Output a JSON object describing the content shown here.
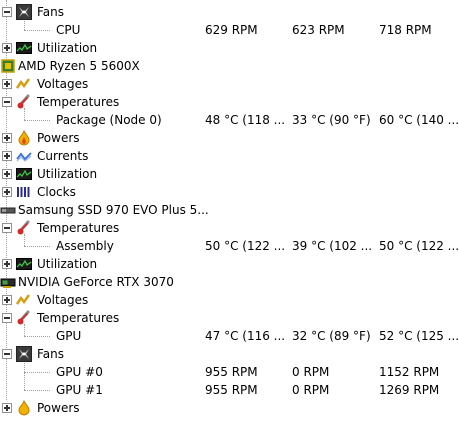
{
  "rows": [
    {
      "label": "Fans"
    },
    {
      "label": "CPU",
      "value": "629 RPM",
      "min": "623 RPM",
      "max": "718 RPM"
    },
    {
      "label": "Utilization"
    },
    {
      "label": "AMD Ryzen 5 5600X"
    },
    {
      "label": "Voltages"
    },
    {
      "label": "Temperatures"
    },
    {
      "label": "Package (Node 0)",
      "value": "48 °C  (118 ...",
      "min": "33 °C  (90 °F)",
      "max": "60 °C  (140 ..."
    },
    {
      "label": "Powers"
    },
    {
      "label": "Currents"
    },
    {
      "label": "Utilization"
    },
    {
      "label": "Clocks"
    },
    {
      "label": "Samsung SSD 970 EVO Plus 5..."
    },
    {
      "label": "Temperatures"
    },
    {
      "label": "Assembly",
      "value": "50 °C  (122 ...",
      "min": "39 °C  (102 ...",
      "max": "50 °C  (122 ..."
    },
    {
      "label": "Utilization"
    },
    {
      "label": "NVIDIA GeForce RTX 3070"
    },
    {
      "label": "Voltages"
    },
    {
      "label": "Temperatures"
    },
    {
      "label": "GPU",
      "value": "47 °C  (116 ...",
      "min": "32 °C  (89 °F)",
      "max": "52 °C  (125 ..."
    },
    {
      "label": "Fans"
    },
    {
      "label": "GPU #0",
      "value": "955 RPM",
      "min": "0 RPM",
      "max": "1152 RPM"
    },
    {
      "label": "GPU #1",
      "value": "955 RPM",
      "min": "0 RPM",
      "max": "1269 RPM"
    },
    {
      "label": "Powers"
    }
  ],
  "icons": {
    "fan": "fan-icon",
    "utilization": "utilization-chart-icon",
    "cpu": "cpu-chip-icon",
    "voltage": "voltage-icon",
    "temperature": "thermometer-icon",
    "power": "flame-icon",
    "current": "current-wave-icon",
    "clock": "clock-bars-icon",
    "drive": "drive-icon",
    "gpu": "gpu-card-icon"
  },
  "colors": {
    "temperature": "#c0392b",
    "voltage": "#d4a017",
    "current": "#3b6fd6",
    "utilization": "#2e7d32",
    "cpu": "#c8a400"
  }
}
